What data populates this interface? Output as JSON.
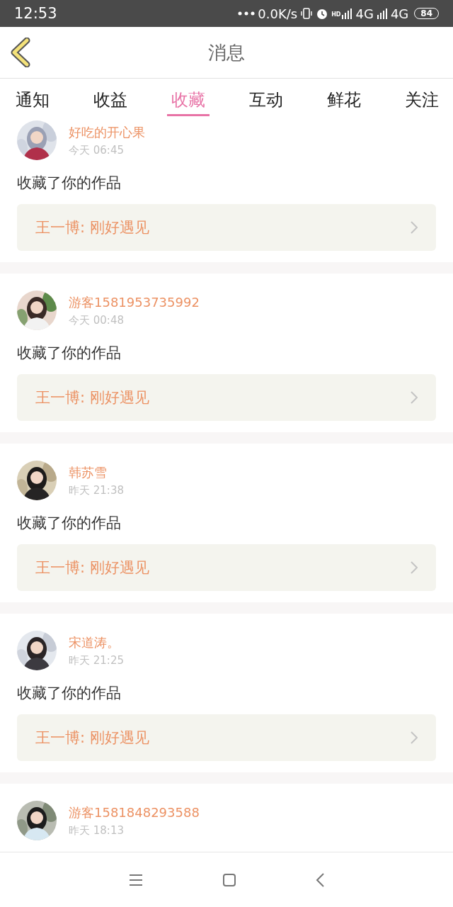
{
  "status_bar": {
    "time": "12:53",
    "speed": "0.0K/s",
    "hd": "HD",
    "network_1": "4G",
    "network_2": "4G",
    "battery": "84"
  },
  "header": {
    "title": "消息"
  },
  "tabs": [
    {
      "label": "通知",
      "selected": false
    },
    {
      "label": "收益",
      "selected": false
    },
    {
      "label": "收藏",
      "selected": true
    },
    {
      "label": "互动",
      "selected": false
    },
    {
      "label": "鲜花",
      "selected": false
    },
    {
      "label": "关注",
      "selected": false
    }
  ],
  "messages": [
    {
      "user": "好吃的开心果",
      "time": "今天 06:45",
      "text": "收藏了你的作品",
      "work": "王一博: 刚好遇见"
    },
    {
      "user": "游客1581953735992",
      "time": "今天 00:48",
      "text": "收藏了你的作品",
      "work": "王一博: 刚好遇见"
    },
    {
      "user": "韩苏雪",
      "time": "昨天 21:38",
      "text": "收藏了你的作品",
      "work": "王一博: 刚好遇见"
    },
    {
      "user": "宋道涛。",
      "time": "昨天 21:25",
      "text": "收藏了你的作品",
      "work": "王一博: 刚好遇见"
    },
    {
      "user": "游客1581848293588",
      "time": "昨天 18:13"
    }
  ]
}
